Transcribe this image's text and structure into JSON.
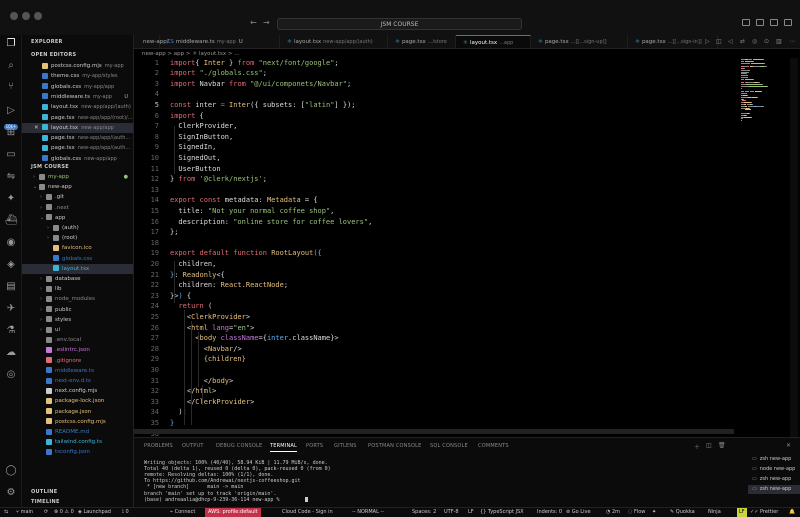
{
  "window": {
    "title": "JSM COURSE"
  },
  "tabs": [
    {
      "label": "new-app/..."
    },
    {
      "label": "middleware.ts",
      "sub": "my-app",
      "mark": "U"
    },
    {
      "label": "layout.tsx",
      "sub": "new-app/app/(auth)"
    },
    {
      "label": "page.tsx",
      "sub": ".../store"
    },
    {
      "label": "layout.tsx",
      "sub": "...app"
    },
    {
      "label": "page.tsx",
      "sub": "...[[...sign-up]]"
    },
    {
      "label": "page.tsx",
      "sub": "...[[...sign-in]]"
    }
  ],
  "breadcrumb": "new-app  >  app  >  ⚛ layout.tsx  >  ...",
  "sidebar": {
    "header": "EXPLORER",
    "open_editors_title": "OPEN EDITORS",
    "open_editors": [
      {
        "name": "postcss.config.mjs",
        "sub": "my-app",
        "icon": "js",
        "color": "#e5c07b"
      },
      {
        "name": "theme.css",
        "sub": "my-app/styles",
        "icon": "css",
        "color": "#3a77c9"
      },
      {
        "name": "globals.css",
        "sub": "my-app/app",
        "icon": "css",
        "color": "#3a77c9"
      },
      {
        "name": "middleware.ts",
        "sub": "my-app",
        "icon": "ts",
        "color": "#3a77c9",
        "mark": "U"
      },
      {
        "name": "layout.tsx",
        "sub": "new-app/app/(auth)",
        "icon": "react",
        "color": "#3fb4d9"
      },
      {
        "name": "page.tsx",
        "sub": "new-app/app/(root)/...",
        "icon": "react",
        "color": "#3fb4d9"
      },
      {
        "name": "layout.tsx",
        "sub": "new-app/app",
        "icon": "react",
        "color": "#3fb4d9",
        "close": "✕"
      },
      {
        "name": "page.tsx",
        "sub": "new-app/app/(auth...",
        "icon": "react",
        "color": "#3fb4d9"
      },
      {
        "name": "page.tsx",
        "sub": "new-app/app/(auth...",
        "icon": "react",
        "color": "#3fb4d9"
      },
      {
        "name": "globals.css",
        "sub": "new-app/app",
        "icon": "css",
        "color": "#3a77c9"
      }
    ],
    "project_title": "JSM COURSE",
    "tree": [
      {
        "name": "my-app",
        "type": "folder",
        "color": "#98c379",
        "depth": 1,
        "mark": "●"
      },
      {
        "name": "new-app",
        "type": "folder-open",
        "color": "#ccc",
        "depth": 1
      },
      {
        "name": ".git",
        "type": "folder",
        "color": "#ccc",
        "depth": 2
      },
      {
        "name": ".next",
        "type": "folder",
        "color": "#888",
        "depth": 2
      },
      {
        "name": "app",
        "type": "folder-open",
        "color": "#ccc",
        "depth": 2
      },
      {
        "name": "(auth)",
        "type": "folder",
        "color": "#ccc",
        "depth": 3
      },
      {
        "name": "(root)",
        "type": "folder",
        "color": "#ccc",
        "depth": 3
      },
      {
        "name": "favicon.ico",
        "type": "file",
        "icon": "ico",
        "color": "#e5c07b",
        "depth": 3
      },
      {
        "name": "globals.css",
        "type": "file",
        "icon": "css",
        "color": "#3a77c9",
        "depth": 3
      },
      {
        "name": "layout.tsx",
        "type": "file",
        "icon": "react",
        "color": "#3fb4d9",
        "depth": 3,
        "selected": true
      },
      {
        "name": "database",
        "type": "folder",
        "color": "#ccc",
        "depth": 2
      },
      {
        "name": "lib",
        "type": "folder",
        "color": "#ccc",
        "depth": 2
      },
      {
        "name": "node_modules",
        "type": "folder",
        "color": "#888",
        "depth": 2
      },
      {
        "name": "public",
        "type": "folder",
        "color": "#ccc",
        "depth": 2
      },
      {
        "name": "styles",
        "type": "folder",
        "color": "#ccc",
        "depth": 2
      },
      {
        "name": "ui",
        "type": "folder",
        "color": "#ccc",
        "depth": 2
      },
      {
        "name": ".env.local",
        "type": "file",
        "icon": "env",
        "color": "#888",
        "depth": 2
      },
      {
        "name": ".eslintrc.json",
        "type": "file",
        "icon": "json",
        "color": "#c678dd",
        "depth": 2
      },
      {
        "name": ".gitignore",
        "type": "file",
        "icon": "git",
        "color": "#e06c75",
        "depth": 2
      },
      {
        "name": "middleware.ts",
        "type": "file",
        "icon": "ts",
        "color": "#3a77c9",
        "depth": 2
      },
      {
        "name": "next-env.d.ts",
        "type": "file",
        "icon": "ts",
        "color": "#3a77c9",
        "depth": 2
      },
      {
        "name": "next.config.mjs",
        "type": "file",
        "icon": "js",
        "color": "#ccc",
        "depth": 2
      },
      {
        "name": "package-lock.json",
        "type": "file",
        "icon": "json",
        "color": "#e5c07b",
        "depth": 2
      },
      {
        "name": "package.json",
        "type": "file",
        "icon": "json",
        "color": "#e5c07b",
        "depth": 2
      },
      {
        "name": "postcss.config.mjs",
        "type": "file",
        "icon": "js",
        "color": "#e5c07b",
        "depth": 2
      },
      {
        "name": "README.md",
        "type": "file",
        "icon": "md",
        "color": "#3a77c9",
        "depth": 2
      },
      {
        "name": "tailwind.config.ts",
        "type": "file",
        "icon": "ts",
        "color": "#3fb4d9",
        "depth": 2
      },
      {
        "name": "tsconfig.json",
        "type": "file",
        "icon": "json",
        "color": "#3a77c9",
        "depth": 2
      }
    ],
    "outline_title": "OUTLINE",
    "timeline_title": "TIMELINE"
  },
  "editor": {
    "lines": [
      [
        [
          "kw",
          "import"
        ],
        [
          "",
          "{ "
        ],
        [
          "ty",
          "Inter"
        ],
        [
          "",
          " } "
        ],
        [
          "kw",
          "from"
        ],
        [
          "",
          " "
        ],
        [
          "st",
          "\"next/font/google\""
        ],
        [
          "",
          ";"
        ]
      ],
      [
        [
          "kw",
          "import"
        ],
        [
          "",
          " "
        ],
        [
          "st",
          "\"./globals.css\""
        ],
        [
          "",
          ";"
        ]
      ],
      [
        [
          "kw",
          "import"
        ],
        [
          "",
          " Navbar "
        ],
        [
          "kw",
          "from"
        ],
        [
          "",
          " "
        ],
        [
          "st",
          "\"@/ui/componets/Navbar\""
        ],
        [
          "",
          ";"
        ]
      ],
      [],
      [
        [
          "kw",
          "const"
        ],
        [
          "",
          " inter "
        ],
        [
          "kw",
          "="
        ],
        [
          "",
          " "
        ],
        [
          "fn",
          "Inter"
        ],
        [
          "",
          "({ subsets: ["
        ],
        [
          "st",
          "\"latin\""
        ],
        [
          "",
          "] });"
        ]
      ],
      [
        [
          "kw",
          "import"
        ],
        [
          "",
          " {"
        ]
      ],
      [
        [
          "",
          "  ClerkProvider,"
        ]
      ],
      [
        [
          "",
          "  SignInButton,"
        ]
      ],
      [
        [
          "",
          "  SignedIn,"
        ]
      ],
      [
        [
          "",
          "  SignedOut,"
        ]
      ],
      [
        [
          "",
          "  UserButton"
        ]
      ],
      [
        [
          "",
          "} "
        ],
        [
          "kw",
          "from"
        ],
        [
          "",
          " "
        ],
        [
          "st",
          "'@clerk/nextjs'"
        ],
        [
          "",
          ";"
        ]
      ],
      [],
      [
        [
          "kw",
          "export"
        ],
        [
          "",
          " "
        ],
        [
          "kw",
          "const"
        ],
        [
          "",
          " metadata: "
        ],
        [
          "ty",
          "Metadata"
        ],
        [
          "",
          " = {"
        ]
      ],
      [
        [
          "",
          "  title: "
        ],
        [
          "st",
          "\"Not your normal coffee shop\""
        ],
        [
          "",
          ","
        ]
      ],
      [
        [
          "",
          "  description: "
        ],
        [
          "st",
          "\"online store for coffee lovers\""
        ],
        [
          "",
          ","
        ]
      ],
      [
        [
          "",
          "};"
        ]
      ],
      [],
      [
        [
          "kw",
          "export"
        ],
        [
          "",
          " "
        ],
        [
          "kw",
          "default"
        ],
        [
          "",
          " "
        ],
        [
          "kw",
          "function"
        ],
        [
          "",
          " "
        ],
        [
          "fn",
          "RootLayout"
        ],
        [
          "pn",
          "({"
        ]
      ],
      [
        [
          "",
          "  children,"
        ]
      ],
      [
        [
          "pn",
          "}"
        ],
        [
          "",
          ": "
        ],
        [
          "ty",
          "Readonly"
        ],
        [
          "",
          "<{"
        ]
      ],
      [
        [
          "",
          "  children: "
        ],
        [
          "ty",
          "React"
        ],
        [
          "",
          "."
        ],
        [
          "ty",
          "ReactNode"
        ],
        [
          "",
          ";"
        ]
      ],
      [
        [
          "",
          "}>"
        ],
        [
          "pn",
          ")"
        ],
        [
          "",
          " {"
        ]
      ],
      [
        [
          "",
          "  "
        ],
        [
          "kw",
          "return"
        ],
        [
          "",
          " ("
        ]
      ],
      [
        [
          "",
          "    <"
        ],
        [
          "tg",
          "ClerkProvider"
        ],
        [
          "",
          ">"
        ]
      ],
      [
        [
          "",
          "    <"
        ],
        [
          "tg",
          "html"
        ],
        [
          "",
          " "
        ],
        [
          "at",
          "lang"
        ],
        [
          "",
          "="
        ],
        [
          "st",
          "\"en\""
        ],
        [
          "",
          ">"
        ]
      ],
      [
        [
          "",
          "      <"
        ],
        [
          "tg",
          "body"
        ],
        [
          "",
          " "
        ],
        [
          "at",
          "className"
        ],
        [
          "",
          "={"
        ],
        [
          "pn",
          "inter"
        ],
        [
          "",
          ".className}>"
        ]
      ],
      [
        [
          "",
          "        <"
        ],
        [
          "tg",
          "Navbar"
        ],
        [
          "",
          "/>"
        ]
      ],
      [
        [
          "",
          "        "
        ],
        [
          "tg",
          "{children}"
        ]
      ],
      [],
      [
        [
          "",
          "        </"
        ],
        [
          "tg",
          "body"
        ],
        [
          "",
          ">"
        ]
      ],
      [
        [
          "",
          "    </"
        ],
        [
          "tg",
          "html"
        ],
        [
          "",
          ">"
        ]
      ],
      [
        [
          "",
          "    </"
        ],
        [
          "tg",
          "ClerkProvider"
        ],
        [
          "",
          ">"
        ]
      ],
      [
        [
          "",
          "  );"
        ]
      ],
      [
        [
          "pn",
          "}"
        ]
      ],
      [],
      []
    ]
  },
  "panel": {
    "tabs": [
      "PROBLEMS",
      "OUTPUT",
      "DEBUG CONSOLE",
      "TERMINAL",
      "PORTS",
      "GITLENS",
      "POSTMAN CONSOLE",
      "SQL CONSOLE",
      "COMMENTS"
    ],
    "active_tab": "TERMINAL",
    "terminal_lines": [
      "Writing objects: 100% (40/40), 58.94 KiB | 11.79 MiB/s, done.",
      "Total 40 (delta 1), reused 0 (delta 0), pack-reused 0 (from 0)",
      "remote: Resolving deltas: 100% (1/1), done.",
      "To https://github.com/Andrewai/nextjs-coffeeshop.git",
      " * [new branch]      main -> main",
      "branch 'main' set up to track 'origin/main'.",
      "(base) andreaalia@dhcp-9-239-36-114 new-app % "
    ],
    "terminals": [
      {
        "label": "zsh  new-app"
      },
      {
        "label": "node  new-app"
      },
      {
        "label": "zsh  new-app"
      },
      {
        "label": "zsh  new-app",
        "selected": true
      }
    ]
  },
  "statusbar": {
    "branch": "main",
    "sync": "⟳",
    "errors": "⊗ 0  ⚠ 0",
    "launchpad": "Launchpad",
    "ports": "⟟ 0",
    "connect": "Connect",
    "aws": "AWS: profile:default",
    "cloudcode": "Cloud Code - Sign in",
    "mode": "-- NORMAL --",
    "spaces": "Spaces: 2",
    "encoding": "UTF-8",
    "eol": "LF",
    "language": "{} TypeScript JSX",
    "indent": "Indents: 0",
    "golive": "Go Live",
    "time": "2m",
    "flow": "Flow",
    "quokka": "Quokka",
    "ninja": "Ninja",
    "lf_badge": "LF",
    "prettier": "Prettier"
  }
}
